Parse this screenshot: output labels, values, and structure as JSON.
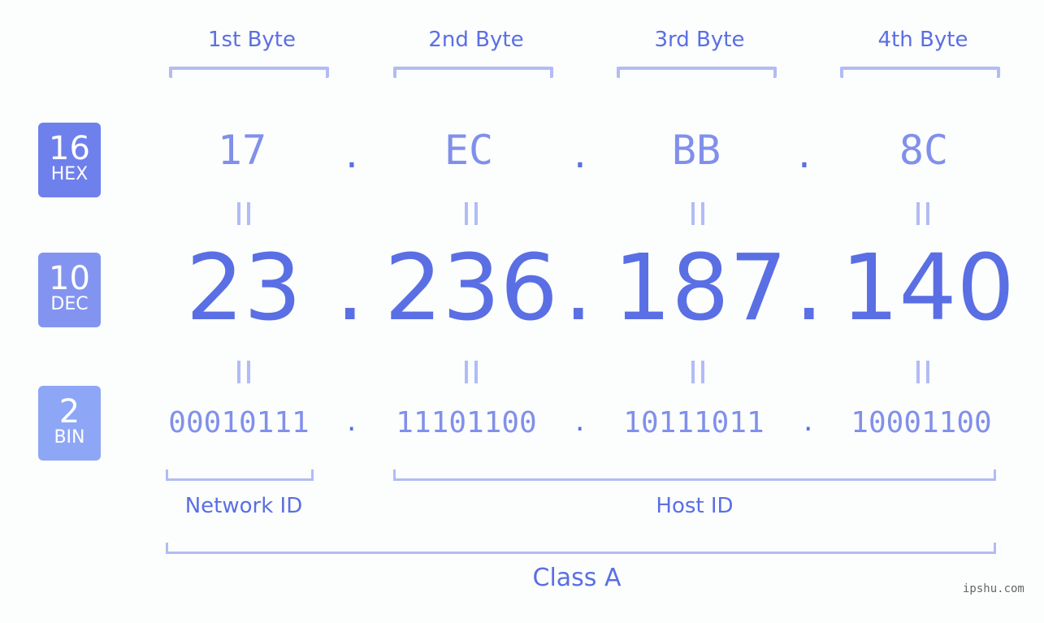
{
  "byte_labels": [
    "1st Byte",
    "2nd Byte",
    "3rd Byte",
    "4th Byte"
  ],
  "badges": {
    "hex": {
      "num": "16",
      "label": "HEX",
      "color": "#6e80ec"
    },
    "dec": {
      "num": "10",
      "label": "DEC",
      "color": "#8394f0"
    },
    "bin": {
      "num": "2",
      "label": "BIN",
      "color": "#8ea6f6"
    }
  },
  "hex_values": [
    "17",
    "EC",
    "BB",
    "8C"
  ],
  "dec_values": [
    "23",
    "236",
    "187",
    "140"
  ],
  "bin_values": [
    "00010111",
    "11101100",
    "10111011",
    "10001100"
  ],
  "separator": ".",
  "network_label": "Network ID",
  "host_label": "Host ID",
  "class_label": "Class A",
  "watermark": "ipshu.com"
}
